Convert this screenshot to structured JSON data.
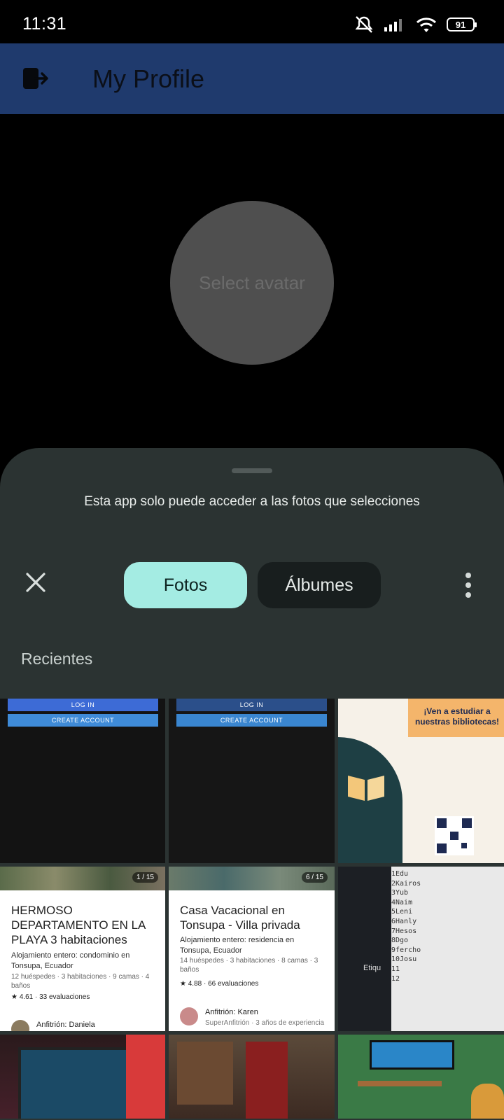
{
  "status_bar": {
    "time": "11:31",
    "battery": "91"
  },
  "app_bar": {
    "title": "My Profile"
  },
  "avatar": {
    "label": "Select avatar"
  },
  "picker": {
    "notice": "Esta app solo puede acceder a las fotos que selecciones",
    "tabs": [
      {
        "label": "Fotos",
        "selected": true
      },
      {
        "label": "Álbumes",
        "selected": false
      }
    ],
    "section": "Recientes"
  },
  "photos": {
    "screenshot1": {
      "login": "LOG IN",
      "create": "CREATE ACCOUNT"
    },
    "screenshot2": {
      "login": "LOG IN",
      "create": "CREATE ACCOUNT"
    },
    "poster": {
      "headline": "¡Ven a estudiar a nuestras bibliotecas!"
    },
    "listing1": {
      "counter": "1 / 15",
      "title": "HERMOSO DEPARTAMENTO EN LA PLAYA 3 habitaciones",
      "subtitle": "Alojamiento entero: condominio en Tonsupa, Ecuador",
      "details": "12 huéspedes · 3 habitaciones · 9 camas · 4 baños",
      "rating": "★ 4.61 · 33 evaluaciones",
      "host": "Anfitrión: Daniela"
    },
    "listing2": {
      "counter": "6 / 15",
      "title": "Casa Vacacional en Tonsupa - Villa privada",
      "subtitle": "Alojamiento entero: residencia en Tonsupa, Ecuador",
      "details": "14 huéspedes · 3 habitaciones · 8 camas · 3 baños",
      "rating": "★ 4.88 · 66 evaluaciones",
      "host": "Anfitrión: Karen",
      "host_detail": "SuperAnfitrión · 3 años de experiencia"
    },
    "notes": {
      "label": "Etiqu",
      "lines": "1Edu\n2Kairos\n3Yub\n4Naim\n5Leni\n6Hanly\n7Hesos\n8Dgo\n9fercho\n10Josu\n11\n12"
    }
  },
  "colors": {
    "app_bar": "#1f3a6d",
    "sheet": "#2b3332",
    "tab_selected": "#a4ece3",
    "tab_unselected": "#181e1e"
  }
}
